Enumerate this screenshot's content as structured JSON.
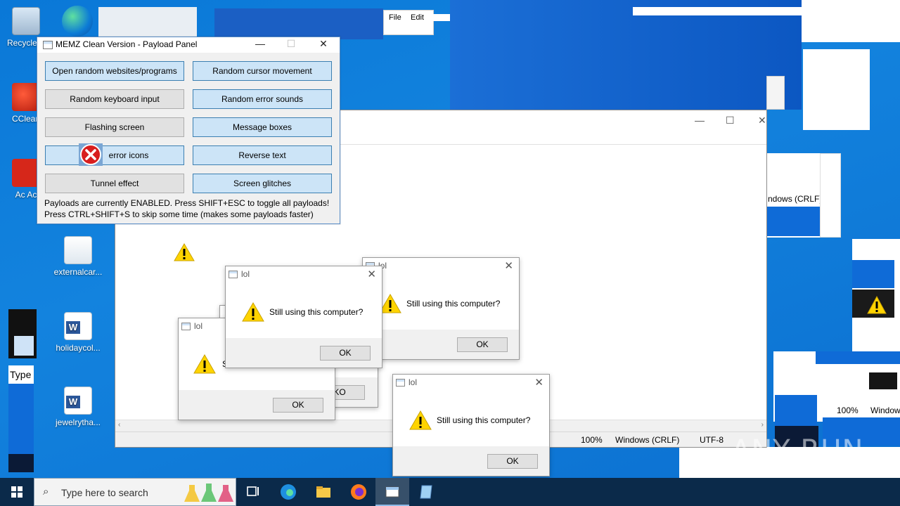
{
  "desktop": {
    "icons": [
      {
        "label": "Recycle B"
      },
      {
        "label": "CClean"
      },
      {
        "label": "Ac Ac"
      },
      {
        "label": "externalcar..."
      },
      {
        "label": "holidaycol..."
      },
      {
        "label": "jewelrytha..."
      }
    ]
  },
  "notepad": {
    "fragment_menu_file": "File",
    "fragment_menu_edit": "Edit",
    "status_zoom": "100%",
    "status_eol": "Windows (CRLF)",
    "status_encoding": "UTF-8",
    "glitch_eol": "ndows (CRLF)",
    "glitch_zoom": "100%",
    "glitch_window": "Window",
    "glitch_type": "Type"
  },
  "panel": {
    "title": "MEMZ Clean Version - Payload Panel",
    "buttons": [
      "Open random websites/programs",
      "Random cursor movement",
      "Random keyboard input",
      "Random error sounds",
      "Flashing screen",
      "Message boxes",
      "Draw error icons",
      "Reverse text",
      "Tunnel effect",
      "Screen glitches"
    ],
    "visible_icons_label": "error icons",
    "note_line1": "Payloads are currently ENABLED. Press SHIFT+ESC to toggle all payloads!",
    "note_line2": "Press CTRL+SHIFT+S to skip some time (makes some payloads faster)"
  },
  "dialogs": {
    "title": "lol",
    "message": "Still using this computer?",
    "ok": "OK",
    "reversed_ok": "KO",
    "partial_msg": "S"
  },
  "taskbar": {
    "search_placeholder": "Type here to search"
  },
  "watermark": "ANY RUN"
}
